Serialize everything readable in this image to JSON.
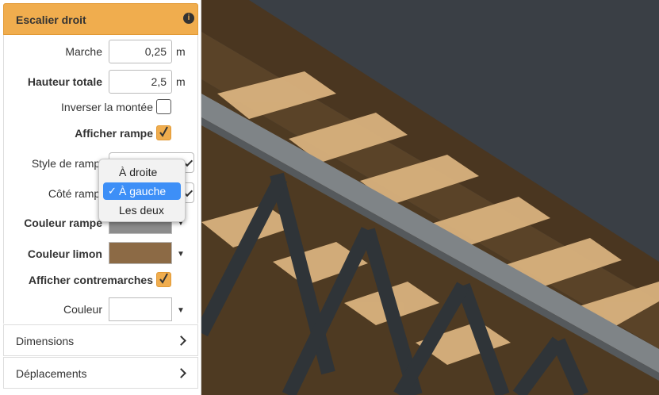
{
  "panel": {
    "title": "Escalier droit",
    "fields": {
      "marche": {
        "label": "Marche",
        "value": "0,25",
        "unit": "m"
      },
      "hauteur": {
        "label": "Hauteur totale",
        "value": "2,5",
        "unit": "m"
      },
      "inverser": {
        "label": "Inverser la montée",
        "checked": false
      },
      "afficher_rampe": {
        "label": "Afficher rampe",
        "checked": true
      },
      "style_rampe": {
        "label": "Style de rampe"
      },
      "cote_rampe": {
        "label": "Côté rampe"
      },
      "couleur_rampe": {
        "label": "Couleur rampe",
        "color": "#8c8c8c"
      },
      "couleur_limon": {
        "label": "Couleur limon",
        "color": "#8c6a45"
      },
      "afficher_contremarches": {
        "label": "Afficher contremarches",
        "checked": true
      },
      "couleur": {
        "label": "Couleur",
        "color": "#ffffff"
      }
    },
    "dropdown": {
      "options": [
        "À droite",
        "À gauche",
        "Les deux"
      ],
      "selected": "À gauche",
      "check": "✓"
    },
    "sections": {
      "dimensions": "Dimensions",
      "deplacements": "Déplacements"
    },
    "caret": "▼"
  },
  "colors": {
    "accent": "#f0ad4e",
    "selection": "#3d8ff7",
    "tread": "#d9b27e",
    "stringer": "#4e3a22",
    "handrail": "#7f8487",
    "wall": "#3a3f45"
  }
}
